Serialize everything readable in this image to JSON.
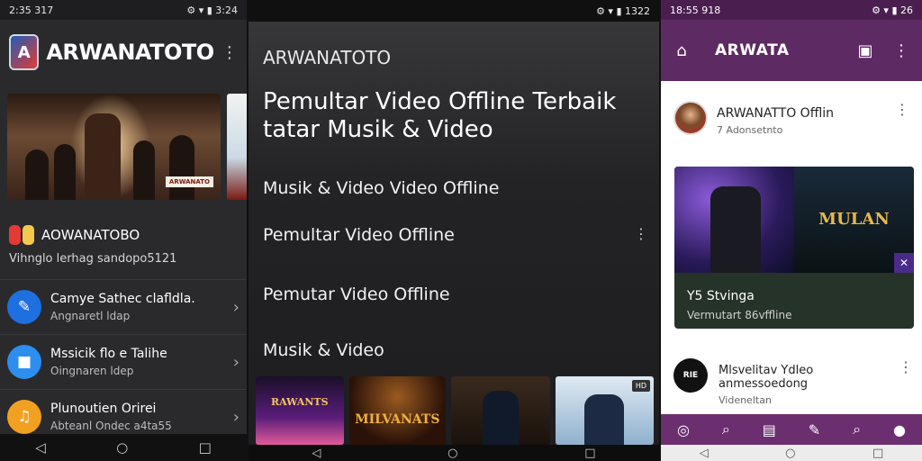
{
  "panel1": {
    "status": {
      "left": "2:35 317",
      "right": "3:24"
    },
    "app_title": "ARWANATOTO",
    "hero_badge": "ARWANATO",
    "channel": {
      "name": "AOWANATOBO",
      "subtitle": "Vihnglo lerhag sandopo5121"
    },
    "list": [
      {
        "title": "Camye Sathec clafldla.",
        "subtitle": "Angnaretl ldap",
        "icon": "pencil-icon",
        "color": "#1e6fe0"
      },
      {
        "title": "Mssicik flo e Talihe",
        "subtitle": "Oingnaren ldep",
        "icon": "video-icon",
        "color": "#2d8ef0"
      },
      {
        "title": "Plunoutien Orirei",
        "subtitle": "Abteanl Ondec a4ta55",
        "icon": "music-note-icon",
        "color": "#f2a020"
      }
    ]
  },
  "panel2": {
    "status": {
      "right": "1322"
    },
    "app_title": "ARWANATOTO",
    "headline": "Pemultar Video Offline Terbaik tatar Musik & Video",
    "rows": [
      "Musik & Video   Video Offline",
      "Pemultar Video Offline",
      "Pemutar Video Offline",
      "Musik & Video"
    ],
    "thumbs": [
      "RAWANTS",
      "MILVANATS"
    ],
    "thumb_badge": "HD"
  },
  "panel3": {
    "status": {
      "left": "18:55 918",
      "right": "26"
    },
    "app_title": "ARWATA",
    "post": {
      "name": "ARWANATTO Offlin",
      "subtitle": "7 Adonsetnto"
    },
    "card": {
      "title": "Y5 Stvinga",
      "subtitle": "Vermutart 86vffline",
      "poster_text": "MULAN"
    },
    "post2": {
      "name": "Mlsvelitav Ydleo anmessoedong",
      "subtitle": "Videneltan",
      "logo": "RIE"
    }
  }
}
